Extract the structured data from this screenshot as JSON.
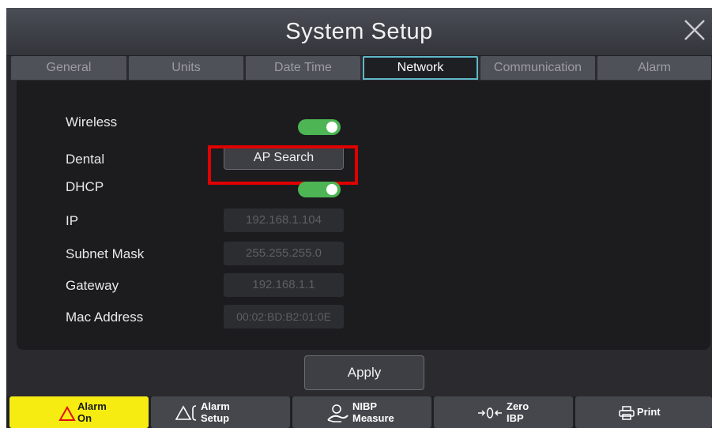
{
  "window": {
    "title": "System Setup"
  },
  "tabs": [
    {
      "label": "General"
    },
    {
      "label": "Units"
    },
    {
      "label": "Date Time"
    },
    {
      "label": "Network"
    },
    {
      "label": "Communication"
    },
    {
      "label": "Alarm"
    }
  ],
  "active_tab": "Network",
  "network": {
    "wireless": {
      "label": "Wireless",
      "state": "on"
    },
    "dental": {
      "label": "Dental",
      "button": "AP Search"
    },
    "dhcp": {
      "label": "DHCP",
      "state": "on"
    },
    "ip": {
      "label": "IP",
      "value": "192.168.1.104"
    },
    "subnet": {
      "label": "Subnet Mask",
      "value": "255.255.255.0"
    },
    "gateway": {
      "label": "Gateway",
      "value": "192.168.1.1"
    },
    "mac": {
      "label": "Mac Address",
      "value": "00:02:BD:B2:01:0E"
    }
  },
  "apply_label": "Apply",
  "softkeys": {
    "alarm_on": {
      "line1": "Alarm",
      "line2": "On"
    },
    "alarm_setup": {
      "line1": "Alarm",
      "line2": "Setup"
    },
    "nibp": {
      "line1": "NIBP",
      "line2": "Measure"
    },
    "zero_ibp": {
      "line1": "Zero",
      "line2": "IBP"
    },
    "print": {
      "line1": "Print"
    }
  },
  "colors": {
    "toggle_on": "#4db553",
    "highlight": "#e00000",
    "alarm_on_bg": "#f6ec12",
    "active_tab_border": "#5fb8c8"
  }
}
